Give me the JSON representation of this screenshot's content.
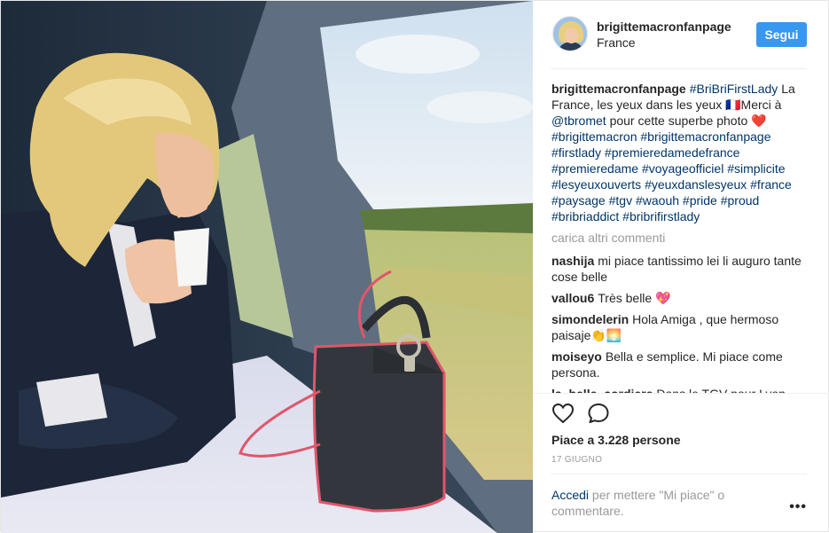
{
  "header": {
    "username": "brigittemacronfanpage",
    "location": "France",
    "follow_label": "Segui"
  },
  "caption": {
    "username": "brigittemacronfanpage",
    "hashtag_first": "#BriBriFirstLady",
    "text_1": "La France, les yeux dans les yeux 🇫🇷Merci à",
    "mention": "@tbromet",
    "text_2": "pour cette superbe photo ❤️",
    "hashtags": [
      "#brigittemacron",
      "#brigittemacronfanpage",
      "#firstlady",
      "#premieredamedefrance",
      "#premieredame",
      "#voyageofficiel",
      "#simplicite",
      "#lesyeuxouverts",
      "#yeuxdanslesyeux",
      "#france",
      "#paysage",
      "#tgv",
      "#waouh",
      "#pride",
      "#proud",
      "#bribriaddict",
      "#bribrifirstlady"
    ]
  },
  "load_more_label": "carica altri commenti",
  "comments": [
    {
      "username": "nashija",
      "text": "mi piace tantissimo lei li auguro tante cose belle"
    },
    {
      "username": "vallou6",
      "text": "Très belle 💖"
    },
    {
      "username": "simondelerin",
      "text": "Hola Amiga , que hermoso paisaje👏🌅"
    },
    {
      "username": "moiseyo",
      "text": "Bella e semplice. Mi piace come persona."
    },
    {
      "username": "la_belle_cordiere",
      "text": "Dans le TGV pour Lyon"
    }
  ],
  "actions": {
    "like_icon": "heart-icon",
    "comment_icon": "comment-icon"
  },
  "likes_text": "Piace a 3.228 persone",
  "date_text": "17 GIUGNO",
  "footer": {
    "login_link": "Accedi",
    "login_text": "per mettere \"Mi piace\" o commentare.",
    "more_label": "•••"
  },
  "colors": {
    "accent": "#3897f0",
    "link": "#003569",
    "muted": "#999999",
    "text": "#262626"
  }
}
